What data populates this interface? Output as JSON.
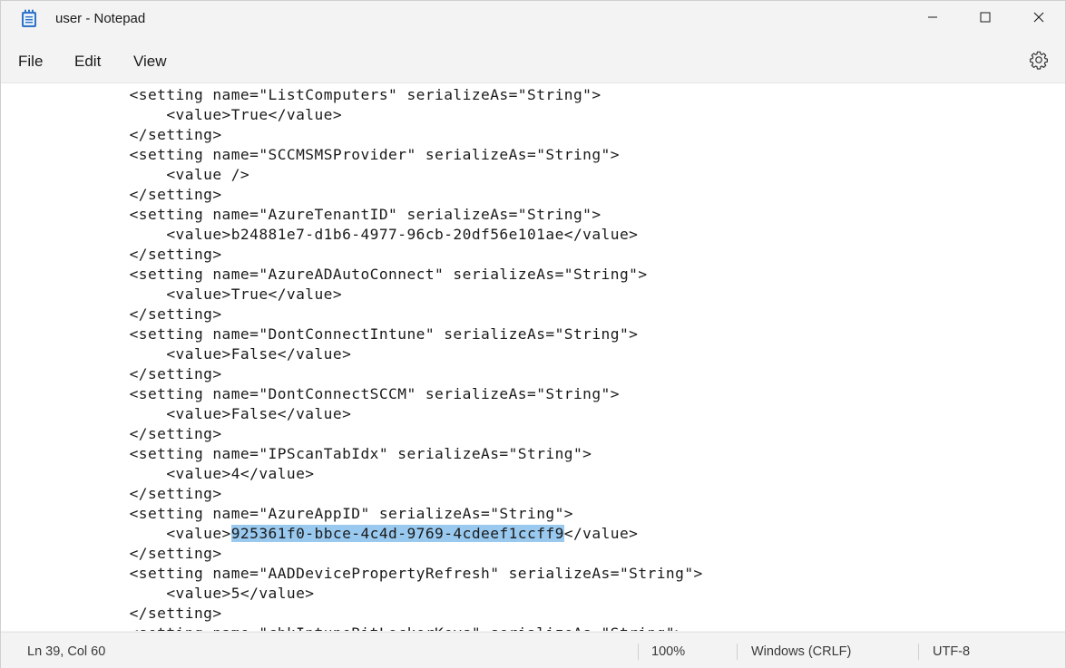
{
  "window": {
    "title": "user - Notepad"
  },
  "icons": {
    "app": "notepad-icon",
    "minimize": "minimize-icon",
    "maximize": "maximize-icon",
    "close": "close-icon",
    "settings": "gear-icon"
  },
  "menu": {
    "file": "File",
    "edit": "Edit",
    "view": "View"
  },
  "editor": {
    "lines": [
      {
        "indent": "        ",
        "text": "<setting name=\"ListComputers\" serializeAs=\"String\">"
      },
      {
        "indent": "            ",
        "text": "<value>True</value>"
      },
      {
        "indent": "        ",
        "text": "</setting>"
      },
      {
        "indent": "        ",
        "text": "<setting name=\"SCCMSMSProvider\" serializeAs=\"String\">"
      },
      {
        "indent": "            ",
        "text": "<value />"
      },
      {
        "indent": "        ",
        "text": "</setting>"
      },
      {
        "indent": "        ",
        "text": "<setting name=\"AzureTenantID\" serializeAs=\"String\">"
      },
      {
        "indent": "            ",
        "text": "<value>b24881e7-d1b6-4977-96cb-20df56e101ae</value>"
      },
      {
        "indent": "        ",
        "text": "</setting>"
      },
      {
        "indent": "        ",
        "text": "<setting name=\"AzureADAutoConnect\" serializeAs=\"String\">"
      },
      {
        "indent": "            ",
        "text": "<value>True</value>"
      },
      {
        "indent": "        ",
        "text": "</setting>"
      },
      {
        "indent": "        ",
        "text": "<setting name=\"DontConnectIntune\" serializeAs=\"String\">"
      },
      {
        "indent": "            ",
        "text": "<value>False</value>"
      },
      {
        "indent": "        ",
        "text": "</setting>"
      },
      {
        "indent": "        ",
        "text": "<setting name=\"DontConnectSCCM\" serializeAs=\"String\">"
      },
      {
        "indent": "            ",
        "text": "<value>False</value>"
      },
      {
        "indent": "        ",
        "text": "</setting>"
      },
      {
        "indent": "        ",
        "text": "<setting name=\"IPScanTabIdx\" serializeAs=\"String\">"
      },
      {
        "indent": "            ",
        "text": "<value>4</value>"
      },
      {
        "indent": "        ",
        "text": "</setting>"
      },
      {
        "indent": "        ",
        "text": "<setting name=\"AzureAppID\" serializeAs=\"String\">"
      },
      {
        "indent": "            ",
        "before": "<value>",
        "selected": "925361f0-bbce-4c4d-9769-4cdeef1ccff9",
        "after": "</value>"
      },
      {
        "indent": "        ",
        "text": "</setting>"
      },
      {
        "indent": "        ",
        "text": "<setting name=\"AADDevicePropertyRefresh\" serializeAs=\"String\">"
      },
      {
        "indent": "            ",
        "text": "<value>5</value>"
      },
      {
        "indent": "        ",
        "text": "</setting>"
      },
      {
        "indent": "        ",
        "text": "<setting name=\"chkIntuneBitLockerKeys\" serializeAs=\"String\">"
      }
    ]
  },
  "status": {
    "position": "Ln 39, Col 60",
    "zoom": "100%",
    "line_ending": "Windows (CRLF)",
    "encoding": "UTF-8"
  },
  "colors": {
    "selection": "#99c9ef",
    "editor_bg": "#ffffff",
    "chrome_bg": "#f3f3f3",
    "app_icon": "#2f74c8"
  }
}
